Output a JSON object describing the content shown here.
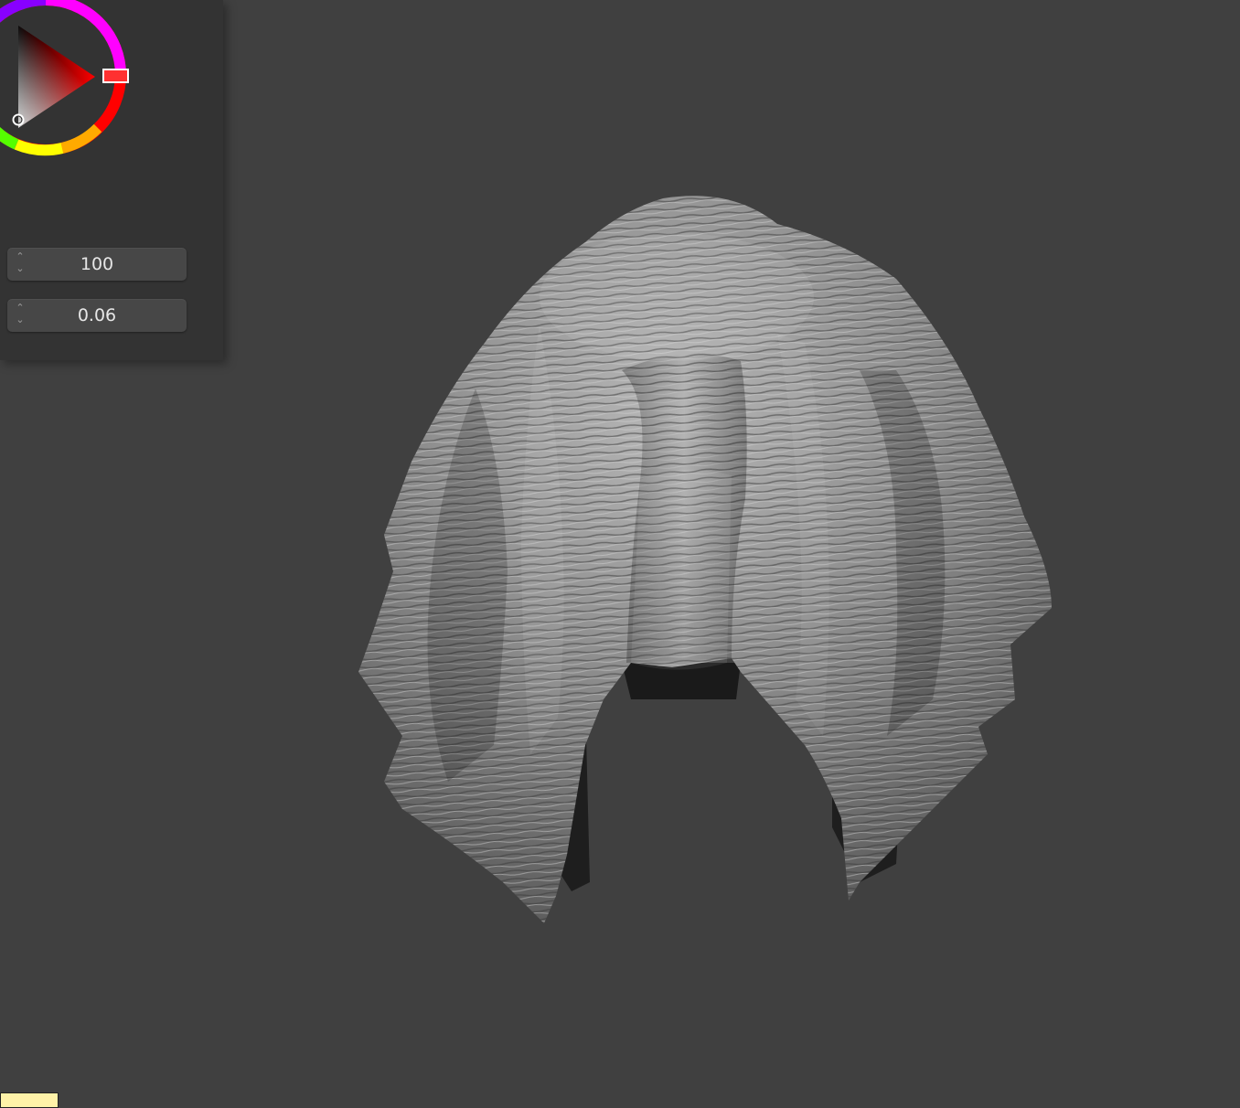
{
  "color_picker": {
    "hue_icon": "hue-ring",
    "selected_color": "#ff0000"
  },
  "fields": {
    "strength": {
      "value": "100"
    },
    "radius": {
      "value": "0.06"
    }
  },
  "spinner_icons": {
    "up": "chevron-up-icon",
    "down": "chevron-down-icon"
  },
  "mesh": {
    "description_icon": "sculpted-cloth-mesh"
  },
  "swatch": {
    "color": "#fff2a8"
  }
}
